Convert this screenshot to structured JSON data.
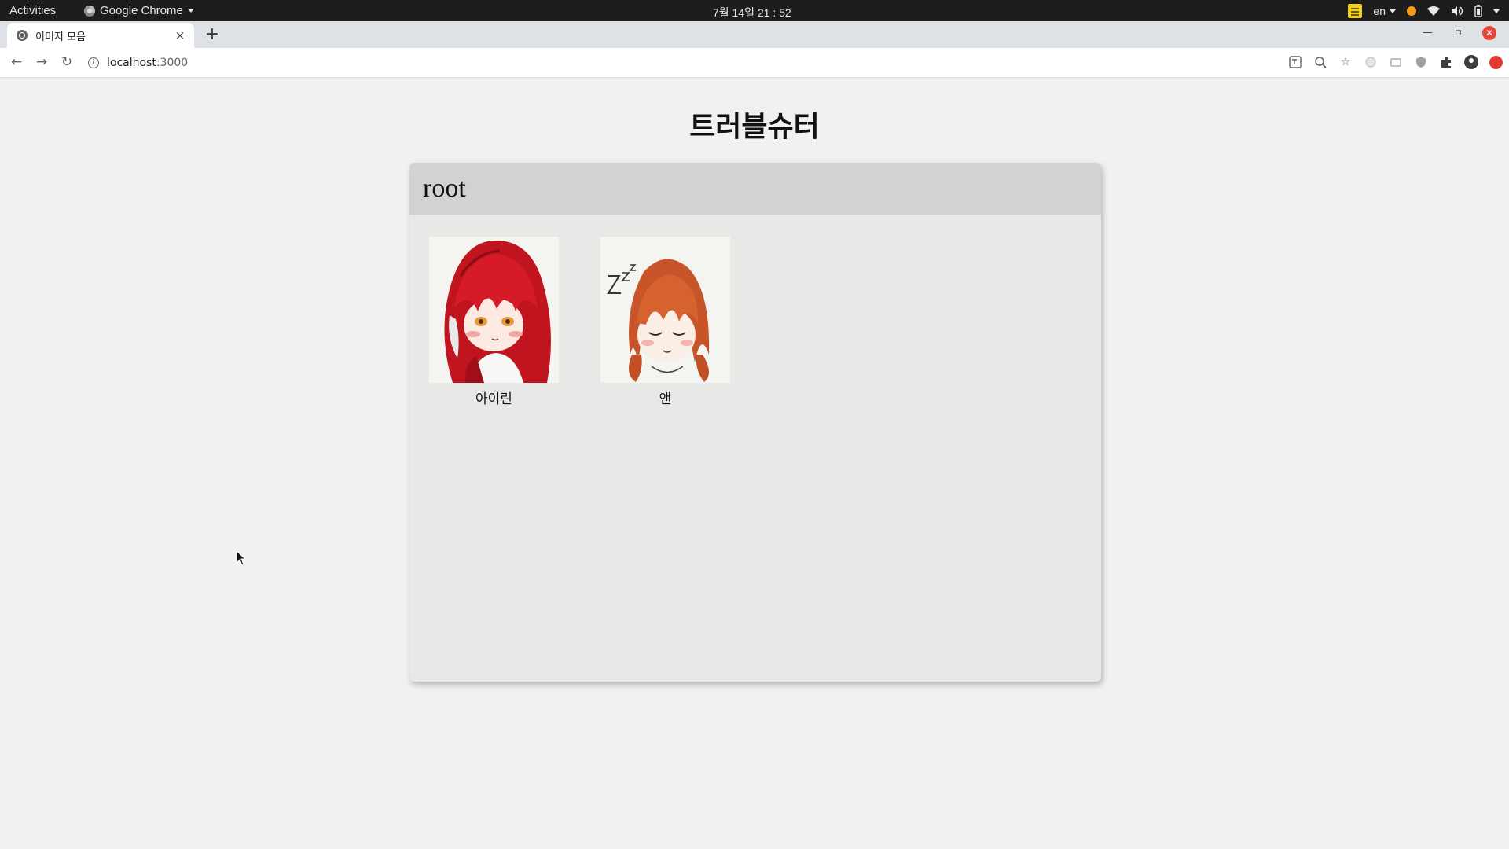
{
  "os": {
    "activities": "Activities",
    "app_name": "Google Chrome",
    "clock": "7월 14일  21 : 52",
    "lang": "en"
  },
  "browser": {
    "tab_title": "이미지 모음",
    "tab_close": "×",
    "new_tab": "+",
    "url_host": "localhost",
    "url_port": ":3000"
  },
  "page": {
    "heading": "트러블슈터",
    "panel_title": "root",
    "items": [
      {
        "caption": "아이린",
        "icon": "red-haired-girl-illustration"
      },
      {
        "caption": "앤",
        "icon": "sleeping-girl-illustration"
      }
    ]
  },
  "colors": {
    "page_bg": "#f1f1ef",
    "panel_bg": "#e8e8e6",
    "panel_header_bg": "#d2d2d0"
  }
}
